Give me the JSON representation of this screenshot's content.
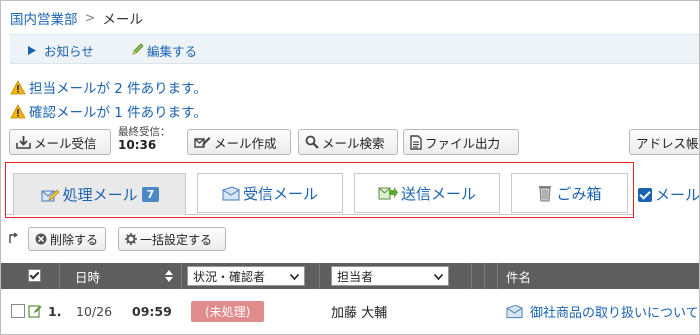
{
  "breadcrumb": {
    "parent": "国内営業部",
    "separator": ">",
    "current": "メール"
  },
  "notice_bar": {
    "notice_label": "お知らせ",
    "edit_label": "編集する"
  },
  "alerts": [
    "担当メールが 2 件あります。",
    "確認メールが 1 件あります。"
  ],
  "toolbar": {
    "receive_label": "メール受信",
    "last_received_label": "最終受信：",
    "last_received_time": "10:36",
    "compose_label": "メール作成",
    "search_label": "メール検索",
    "export_label": "ファイル出力",
    "address_label": "アドレス帳"
  },
  "tabs": [
    {
      "label": "処理メール",
      "badge": "7",
      "icon": "processing-mail-icon"
    },
    {
      "label": "受信メール",
      "icon": "inbox-icon"
    },
    {
      "label": "送信メール",
      "icon": "sent-mail-icon"
    },
    {
      "label": "ごみ箱",
      "icon": "trash-icon"
    }
  ],
  "filter_checkbox_label": "メール",
  "actions": {
    "delete_label": "削除する",
    "bulk_label": "一括設定する"
  },
  "table": {
    "headers": {
      "date": "日時",
      "status_select": "状況・確認者",
      "assignee_select": "担当者",
      "subject": "件名"
    },
    "rows": [
      {
        "num": "1.",
        "date": "10/26",
        "time": "09:59",
        "status": "(未処理)",
        "assignee": "加藤 大輔",
        "subject": "御社商品の取り扱いについて"
      }
    ]
  },
  "colors": {
    "link": "#1a63b3",
    "highlight": "#e2262b",
    "header_bg": "#5e5e5e",
    "status_badge": "#e08c8c",
    "badge": "#4c88c4"
  }
}
